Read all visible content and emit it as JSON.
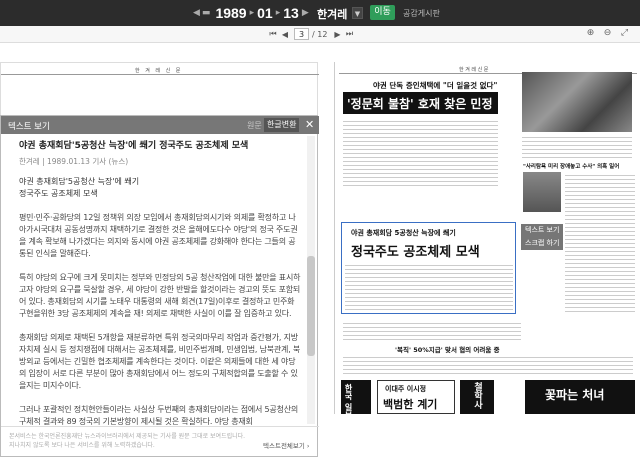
{
  "topbar": {
    "year": "1989",
    "month": "01",
    "day": "13",
    "paper": "한겨레",
    "move_label": "이동",
    "notice_label": "공감게시판"
  },
  "pager": {
    "current": "3",
    "total": "/ 12"
  },
  "text_panel": {
    "title": "텍스트 보기",
    "original_tab": "원문",
    "convert_tab": "한글변환",
    "article_title": "야권 총재회담'5공청산 늑장'에 쐐기 정국주도 공조체제 모색",
    "meta": "한겨레 | 1989.01.13 기사 (뉴스)",
    "subtitle_1": "야권 총재회담'5공청산 늑장'에 쐐기",
    "subtitle_2": "정국주도 공조체제 모색",
    "paragraphs": [
      "평민·민주·공화당의 12일 정책위 의장 모임에서 총재회담의시기와 의제를 확정하고 나아가시국대처 공동성명까지 채택하기로 결정한 것은 올해에도다수 야당'의 정국 주도권을 계속 확보해 나가겠다는 의지와 동시에 야권 공조체제를 강화해야 한다는 그들의 공통된 인식을 말해준다.",
      "특히 야당의 요구에 크게 못미치는 정부와 민정당의 5공 청산작업에 대한 불만을 표시하고자 야당의 요구를 묵살할 경우, 세 야당이 강한 반발을 할것이라는 경고의 뜻도 포함되어 있다. 총재회담의 시기를 노태우 대통령의 새해 회견(17일)이후로 결정하고 민주화 구현을위한 3당 공조체제의 계속을 재! 의제로 채택한 사실이 이를 잘 입증하고 있다.",
      "총재회담 의제로 채택된 5개항을 재분류하면 특위 정국의마무리 작업과 중간평가, 지방자치제 실시 등 정치쟁점에 대해서는 공조체제를, 비민주법개폐, 민생입법, 남북관계, 북방외교 등에서는 긴밀한 협조체제를 계속한다는 것이다. 이같은 의제들에 대한 세 야당의 입장이 서로 다른 부분이 많아 총재회담에서 어느 정도의 구체적합의를 도출할 수 있을지는 미지수이다.",
      "그러나 포괄적인 정치현안들이라는 사실상 두번째의 총재회담이라는 점에서 5공청산의 구체적 결과와 89 정국의 기본방향이 제시될 것은 확실하다. 야당 총재회"
    ],
    "footer_note_1": "본서비스는 한국언론진흥재단 뉴스라이브러리에서 제공되는 기사를 원문 그대로 보여드립니다.",
    "footer_note_2": "지나치지 않도록 보다 나은 서비스를 위해 노력하겠습니다.",
    "footer_button": "텍스트전체보기 ›"
  },
  "newspaper_right": {
    "masthead": "한 겨 레 신 문",
    "headline_1": "야권 단독 증인채택에 \"더 일을것 없다\"",
    "headline_2": "'정문회 불참' 호재 찾은 민정",
    "headline_3": "야권 총재회담 5공청산 늑장에 쐐기",
    "headline_4": "정국주도 공조체제 모색",
    "headline_5": "'복직' 50%지급' 맞서 협의 어려움 중",
    "caption_1": "\"사리탐욕 미리 장애놓고 수사\" 의혹 일어",
    "ad_1": "한국 일보사",
    "ad_2": "이대주 이시정",
    "ad_3": "백범한 계기",
    "ad_4": "철학사",
    "ad_5": "꽃파는 처녀",
    "overlay_1": "텍스트 보기",
    "overlay_2": "스크랩 하기"
  },
  "newspaper_left": {
    "masthead": "한 겨 레 신 문"
  }
}
